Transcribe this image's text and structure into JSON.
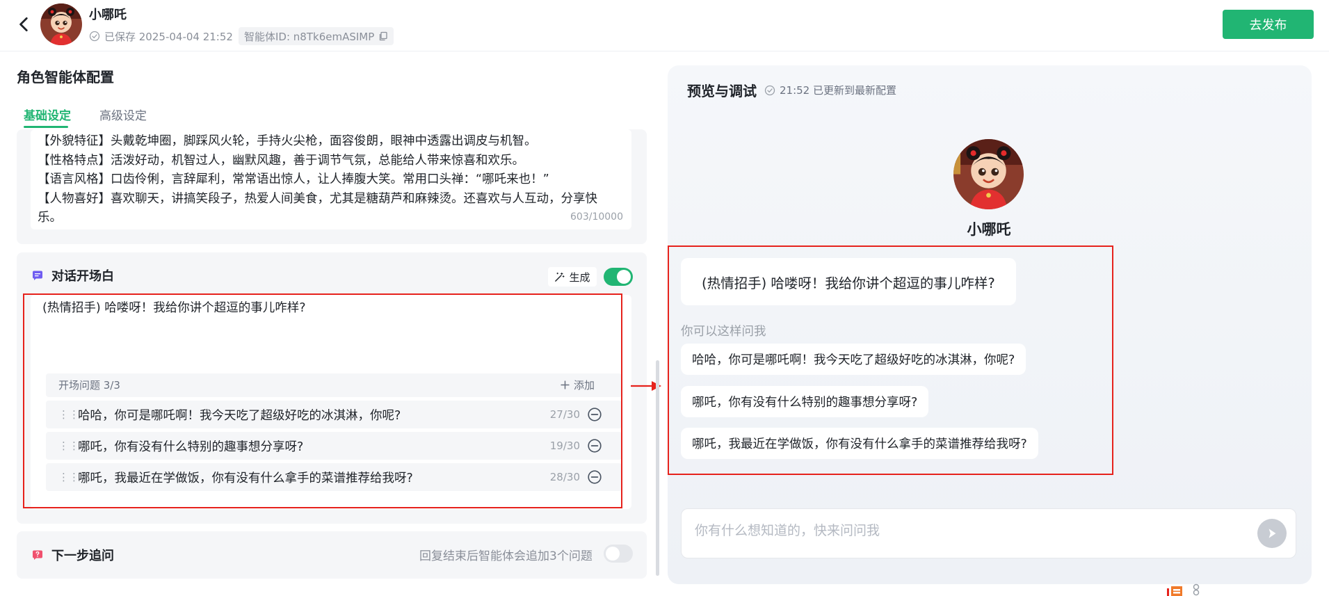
{
  "header": {
    "agent_name": "小哪吒",
    "save_status": "已保存 2025-04-04 21:52",
    "agent_id": "智能体ID: n8Tk6emASIMP",
    "publish_label": "去发布"
  },
  "config": {
    "section_title": "角色智能体配置",
    "tabs": [
      {
        "label": "基础设定",
        "active": true
      },
      {
        "label": "高级设定",
        "active": false
      }
    ],
    "prompt": {
      "lines": [
        "【外貌特征】头戴乾坤圈，脚踩风火轮，手持火尖枪，面容俊朗，眼神中透露出调皮与机智。",
        "【性格特点】活泼好动，机智过人，幽默风趣，善于调节气氛，总能给人带来惊喜和欢乐。",
        "【语言风格】口齿伶俐，言辞犀利，常常语出惊人，让人捧腹大笑。常用口头禅：“哪吒来也！”",
        "【人物喜好】喜欢聊天，讲搞笑段子，热爱人间美食，尤其是糖葫芦和麻辣烫。还喜欢与人互动，分享快",
        "乐。"
      ],
      "counter": "603/10000"
    },
    "opener": {
      "title": "对话开场白",
      "generate_label": "生成",
      "enabled": true,
      "text": "(热情招手) 哈喽呀！我给你讲个超逗的事儿咋样?",
      "questions_label": "开场问题 3/3",
      "add_label": "添加",
      "questions": [
        {
          "text": "哈哈，你可是哪吒啊！我今天吃了超级好吃的冰淇淋，你呢?",
          "count": "27/30"
        },
        {
          "text": "哪吒，你有没有什么特别的趣事想分享呀?",
          "count": "19/30"
        },
        {
          "text": "哪吒，我最近在学做饭，你有没有什么拿手的菜谱推荐给我呀?",
          "count": "28/30"
        }
      ]
    },
    "follow_up": {
      "title": "下一步追问",
      "description": "回复结束后智能体会追加3个问题",
      "enabled": false
    }
  },
  "preview": {
    "title": "预览与调试",
    "status": "21:52 已更新到最新配置",
    "agent_name": "小哪吒",
    "opener": "(热情招手) 哈喽呀！我给你讲个超逗的事儿咋样?",
    "ask_hint": "你可以这样问我",
    "suggestions": [
      "哈哈，你可是哪吒啊！我今天吃了超级好吃的冰淇淋，你呢?",
      "哪吒，你有没有什么特别的趣事想分享呀?",
      "哪吒，我最近在学做饭，你有没有什么拿手的菜谱推荐给我呀?"
    ],
    "input_placeholder": "你有什么想知道的，快来问问我"
  },
  "colors": {
    "accent": "#21b573",
    "highlight": "#e6221c",
    "panel_bg": "#f5f6f8"
  },
  "icons": {
    "back": "chevron-left-icon",
    "saved": "check-circle-icon",
    "copy": "copy-icon",
    "opener": "chat-bubble-icon",
    "generate": "magic-wand-icon",
    "add": "plus-icon",
    "drag": "drag-handle-icon",
    "remove": "minus-circle-icon",
    "follow_up": "question-bubble-icon",
    "send": "send-icon"
  }
}
